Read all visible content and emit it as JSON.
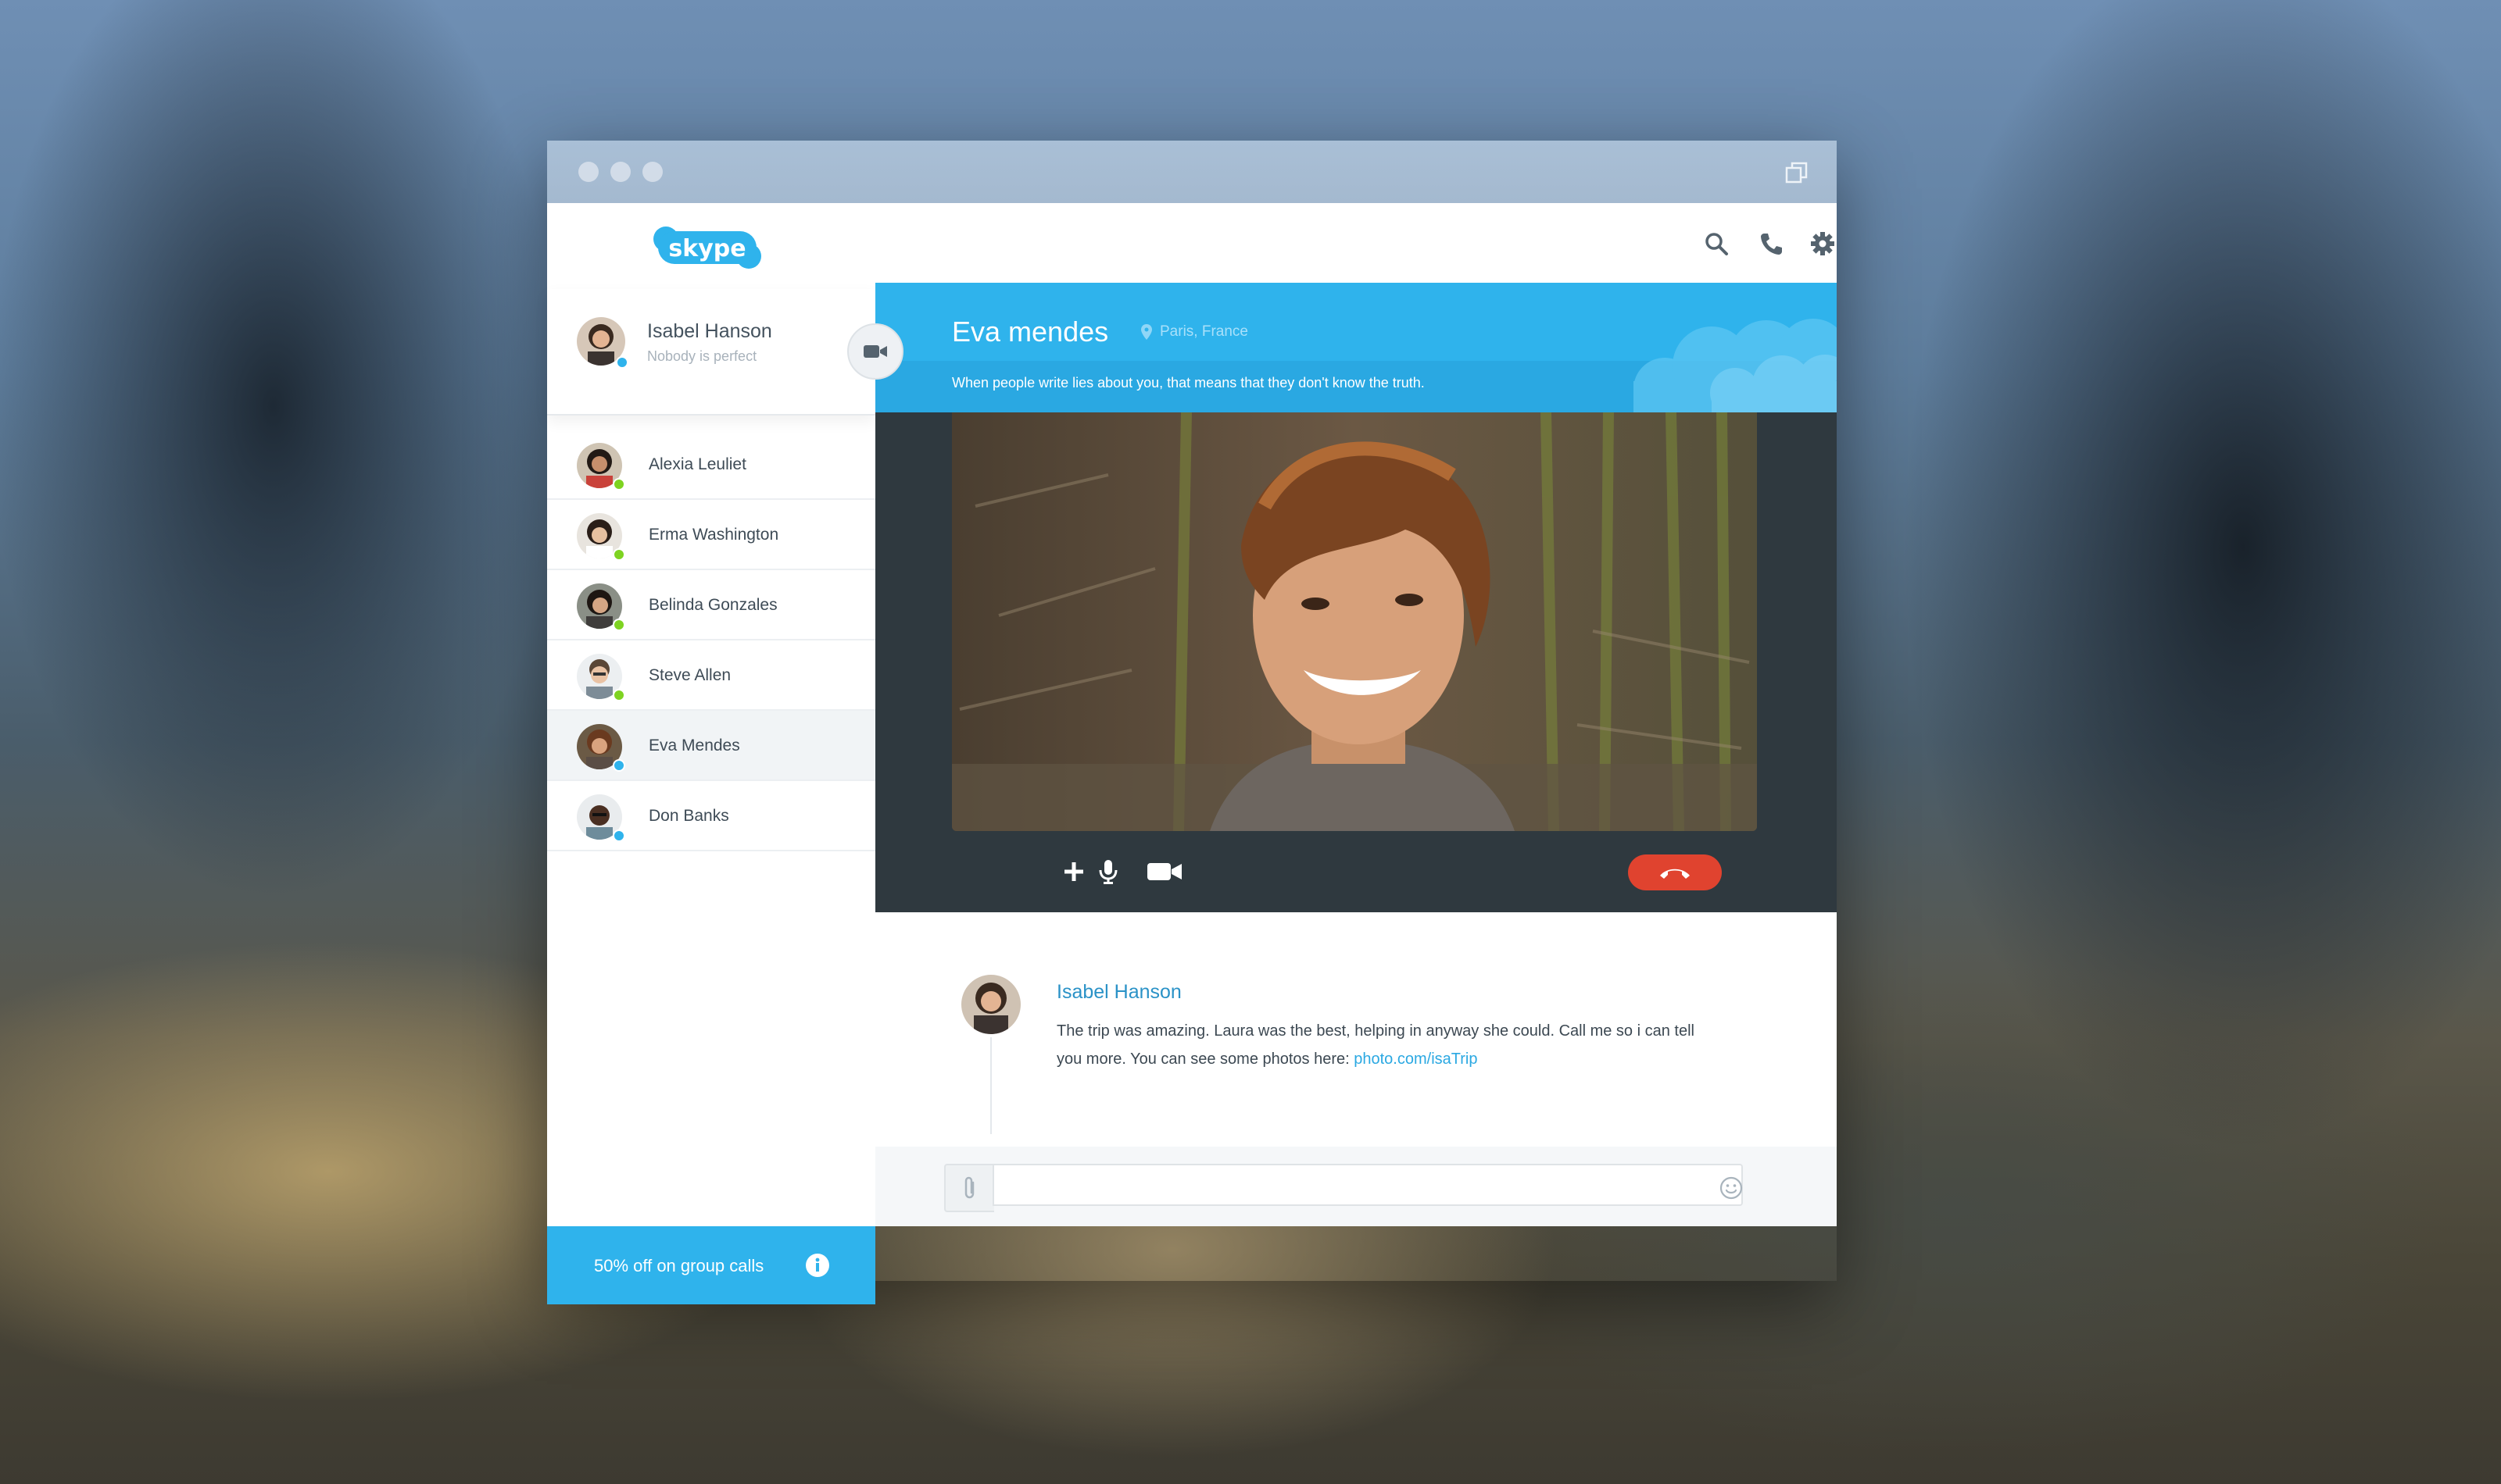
{
  "window": {
    "controls": [
      "close",
      "minimize",
      "zoom"
    ],
    "restore_icon": "restore-window-icon"
  },
  "brand": {
    "logo_text": "skype",
    "color": "#2fb3ec"
  },
  "me": {
    "name": "Isabel Hanson",
    "status": "Nobody is perfect",
    "presence": "online-blue",
    "video_icon": "video-camera-icon"
  },
  "contacts": [
    {
      "name": "Alexia Leuliet",
      "presence_color": "#7ed321"
    },
    {
      "name": "Erma Washington",
      "presence_color": "#7ed321"
    },
    {
      "name": "Belinda Gonzales",
      "presence_color": "#7ed321"
    },
    {
      "name": "Steve Allen",
      "presence_color": "#7ed321"
    },
    {
      "name": "Eva Mendes",
      "presence_color": "#2fb3ec",
      "active": true
    },
    {
      "name": "Don Banks",
      "presence_color": "#2fb3ec"
    }
  ],
  "promo": {
    "text": "50% off on group calls",
    "icon": "info-icon"
  },
  "toolbar": {
    "icons": [
      "search-icon",
      "phone-icon",
      "gear-icon"
    ]
  },
  "conversation": {
    "contact_name": "Eva mendes",
    "location": "Paris, France",
    "mood": "When people write lies about you, that means that they don't know the truth."
  },
  "call_controls": {
    "icons": [
      "plus-icon",
      "microphone-icon",
      "video-camera-icon",
      "hang-up-icon"
    ],
    "hangup_color": "#e0432f"
  },
  "message": {
    "author": "Isabel Hanson",
    "text": "The trip was amazing. Laura was the best, helping in anyway she could. Call me so i can tell you more. You can see some photos here: ",
    "link": "photo.com/isaTrip"
  },
  "composer": {
    "value": "",
    "placeholder": ""
  }
}
